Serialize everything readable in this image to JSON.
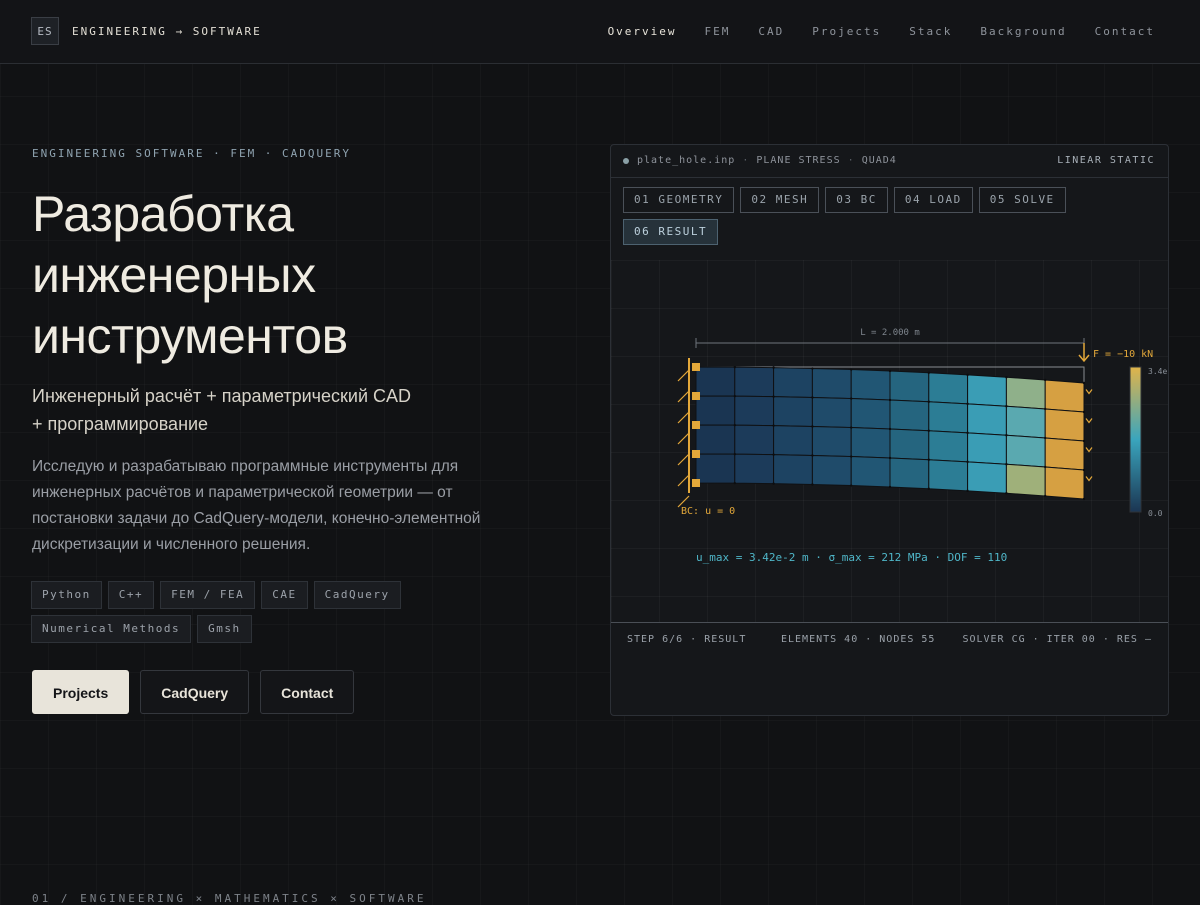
{
  "nav": {
    "logo_mark": "ES",
    "logo_text": "ENGINEERING → SOFTWARE",
    "links": [
      "Overview",
      "FEM",
      "CAD",
      "Projects",
      "Stack",
      "Background",
      "Contact"
    ]
  },
  "hero": {
    "eyebrow": "ENGINEERING SOFTWARE · FEM · CADQUERY",
    "title_lines": [
      "Разработка",
      "инженерных",
      "инструментов"
    ],
    "subtitle_lines": [
      "Инженерный расчёт + параметрический CAD",
      "+ программирование"
    ],
    "description": "Исследую и разрабатываю программные инструменты для инженерных расчётов и параметрической геометрии — от постановки задачи до CadQuery-модели, конечно-элементной дискретизации и численного решения.",
    "tags": [
      "Python",
      "C++",
      "FEM / FEA",
      "CAE",
      "CadQuery",
      "Numerical Methods",
      "Gmsh"
    ],
    "buttons": [
      "Projects",
      "CadQuery",
      "Contact"
    ]
  },
  "panel": {
    "file": "plate_hole.inp",
    "mode": "PLANE STRESS",
    "element": "QUAD4",
    "analysis": "LINEAR STATIC",
    "steps": [
      "01 GEOMETRY",
      "02 MESH",
      "03 BC",
      "04 LOAD",
      "05 SOLVE",
      "06 RESULT"
    ],
    "active_step": 5,
    "viz": {
      "length_label": "L = 2.000 m",
      "force_label": "F = −10 kN",
      "bc_label": "BC: u = 0",
      "colorbar_max": "3.4e",
      "colorbar_min": "0.0",
      "result_line": "u_max = 3.42e-2 m · σ_max = 212 MPa · DOF = 110"
    },
    "footer": {
      "step": "STEP 6/6 · RESULT",
      "mesh": "ELEMENTS 40 · NODES 55",
      "solver": "SOLVER CG · ITER 00 · RES —"
    }
  },
  "section_label": "01 / ENGINEERING × MATHEMATICS × SOFTWARE",
  "colors": {
    "accent": "#e3a83a",
    "result_text": "#4fb6c8",
    "background": "#111214"
  }
}
